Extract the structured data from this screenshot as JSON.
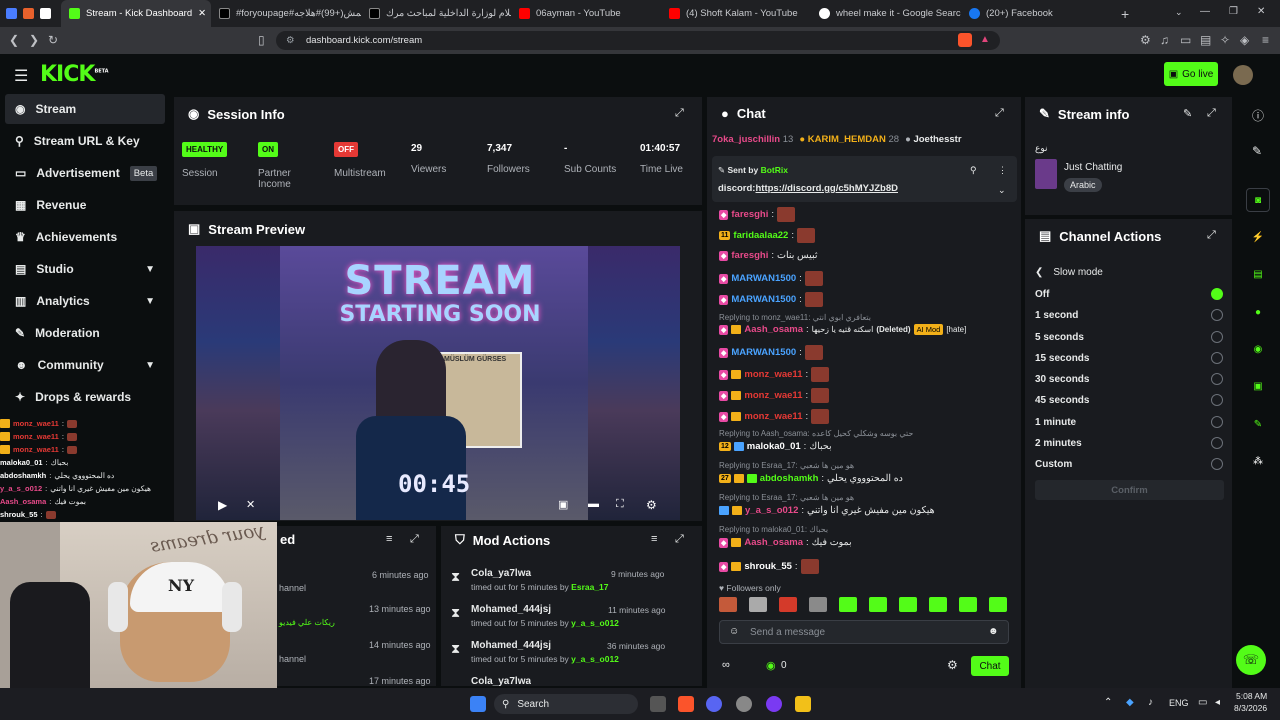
{
  "browser": {
    "tabs": [
      {
        "label": "Stream - Kick Dashboard",
        "active": true
      },
      {
        "label": "#foryoupage#عمش(+99)#هلاجه"
      },
      {
        "label": "استعلام لوزارة الداخلية لمباحث مرك"
      },
      {
        "label": "06ayman - YouTube"
      },
      {
        "label": "(4) Shoft Kalam - YouTube"
      },
      {
        "label": "wheel make it - Google Search"
      },
      {
        "label": "(20+) Facebook"
      }
    ],
    "url": "dashboard.kick.com/stream"
  },
  "header": {
    "logo": "KICK",
    "logo_sup": "BETA",
    "go_live": "Go live"
  },
  "sidebar": {
    "items": [
      {
        "label": "Stream",
        "icon": "broadcast-icon"
      },
      {
        "label": "Stream URL & Key",
        "icon": "link-icon"
      },
      {
        "label": "Advertisement",
        "icon": "monitor-icon",
        "badge": "Beta"
      },
      {
        "label": "Revenue",
        "icon": "revenue-icon"
      },
      {
        "label": "Achievements",
        "icon": "trophy-icon"
      },
      {
        "label": "Studio",
        "icon": "studio-icon"
      },
      {
        "label": "Analytics",
        "icon": "analytics-icon"
      },
      {
        "label": "Moderation",
        "icon": "wrench-icon"
      },
      {
        "label": "Community",
        "icon": "people-icon"
      },
      {
        "label": "Drops & rewards",
        "icon": "gift-icon"
      }
    ]
  },
  "session": {
    "title": "Session Info",
    "stats": [
      {
        "value": "HEALTHY",
        "label": "Session",
        "badge": true,
        "color": "#53fc18"
      },
      {
        "value": "ON",
        "label": "Partner Income",
        "badge": true,
        "color": "#53fc18"
      },
      {
        "value": "OFF",
        "label": "Multistream",
        "badge": true,
        "color": "#e53935"
      },
      {
        "value": "29",
        "label": "Viewers"
      },
      {
        "value": "7,347",
        "label": "Followers"
      },
      {
        "value": "-",
        "label": "Sub Counts"
      },
      {
        "value": "01:40:57",
        "label": "Time Live"
      }
    ]
  },
  "preview": {
    "title": "Stream Preview",
    "overlay_line1": "STREAM",
    "overlay_line2": "STARTING SOON",
    "poster": "MÜSLÜM GÜRSES",
    "countdown": "00:45"
  },
  "recent": {
    "title": "ed",
    "items": [
      {
        "time": "6 minutes ago",
        "sub": "hannel"
      },
      {
        "time": "13 minutes ago",
        "sub": "ريكات علي فيديو"
      },
      {
        "time": "14 minutes ago",
        "sub": "hannel"
      },
      {
        "time": "17 minutes ago",
        "sub": ""
      }
    ]
  },
  "mod_actions": {
    "title": "Mod Actions",
    "items": [
      {
        "user": "Cola_ya7lwa",
        "time": "9 minutes ago",
        "action": "timed out for 5 minutes by",
        "by": "Esraa_17"
      },
      {
        "user": "Mohamed_444jsj",
        "time": "11 minutes ago",
        "action": "timed out for 5 minutes by",
        "by": "y_a_s_o012"
      },
      {
        "user": "Mohamed_444jsj",
        "time": "36 minutes ago",
        "action": "timed out for 5 minutes by",
        "by": "y_a_s_o012"
      },
      {
        "user": "Cola_ya7lwa",
        "time": "",
        "action": "",
        "by": ""
      }
    ]
  },
  "chat": {
    "title": "Chat",
    "top_gifters": [
      {
        "name": "7oka_juschillin",
        "count": "13"
      },
      {
        "name": "KARIM_HEMDAN",
        "count": "28"
      },
      {
        "name": "Joethesstr",
        "count": ""
      }
    ],
    "pinned": {
      "sent_by": "Sent by",
      "bot": "BotRix",
      "text": "discord:",
      "link": "https://discord.gg/c5hMYJZb8D"
    },
    "messages": [
      {
        "name": "faresghi",
        "color": "#e84a8a",
        "text": ""
      },
      {
        "name": "faridaalaa22",
        "color": "#53fc18",
        "text": "",
        "level": "11"
      },
      {
        "name": "faresghi",
        "color": "#e84a8a",
        "text": "ثبيس بنات"
      },
      {
        "name": "MARWAN1500",
        "color": "#4aa3ff",
        "text": ""
      },
      {
        "name": "MARWAN1500",
        "color": "#4aa3ff",
        "text": ""
      },
      {
        "reply": "Replying to monz_wae11: بتعافري ابوي انتي",
        "name": "Aash_osama",
        "color": "#e84a8a",
        "text": "اسكته قتيه يا زحيها",
        "deleted": "(Deleted)",
        "ai": "AI Mod",
        "tag": "[hate]"
      },
      {
        "name": "MARWAN1500",
        "color": "#4aa3ff",
        "text": ""
      },
      {
        "name": "monz_wae11",
        "color": "#e53935",
        "text": ""
      },
      {
        "name": "monz_wae11",
        "color": "#e53935",
        "text": ""
      },
      {
        "name": "monz_wae11",
        "color": "#e53935",
        "text": ""
      },
      {
        "reply": "Replying to Aash_osama: حتي بوسه وشكلي كحيل كاعده",
        "name": "maloka0_01",
        "color": "#ffffff",
        "text": "بحباك",
        "level": "12"
      },
      {
        "reply": "Replying to Esraa_17: هو مين ها شعبي",
        "name": "abdoshamkh",
        "color": "#53fc18",
        "text": "ده المحتوووي يحلي",
        "level": "27"
      },
      {
        "reply": "Replying to Esraa_17: هو مين ها شعبي",
        "name": "y_a_s_o012",
        "color": "#e84a8a",
        "text": "هيكون مين مفيش غيري انا واتني"
      },
      {
        "reply": "Replying to maloka0_01: بحباك",
        "name": "Aash_osama",
        "color": "#e84a8a",
        "text": "بموت فيك"
      },
      {
        "name": "shrouk_55",
        "color": "#ffffff",
        "text": ""
      }
    ],
    "followers_only": "Followers only",
    "placeholder": "Send a message",
    "count": "0",
    "send": "Chat"
  },
  "stream_info": {
    "title": "Stream info",
    "category_label": "نوع",
    "category": "Just Chatting",
    "tag": "Arabic"
  },
  "channel_actions": {
    "title": "Channel Actions",
    "slow_mode": "Slow mode",
    "options": [
      "Off",
      "1 second",
      "5 seconds",
      "15 seconds",
      "30 seconds",
      "45 seconds",
      "1 minute",
      "2 minutes",
      "Custom"
    ],
    "selected": "Off",
    "confirm": "Confirm"
  },
  "overlay_chat": [
    {
      "name": "monz_wae11",
      "color": "#e53935",
      "text": ""
    },
    {
      "name": "monz_wae11",
      "color": "#e53935",
      "text": ""
    },
    {
      "name": "monz_wae11",
      "color": "#e53935",
      "text": ""
    },
    {
      "name": "maloka0_01",
      "color": "#ffffff",
      "text": "بحباك"
    },
    {
      "name": "abdoshamkh",
      "color": "#ffffff",
      "text": "ده المحتوووي يحلي"
    },
    {
      "name": "y_a_s_o012",
      "color": "#e84a8a",
      "text": "هيكون مين مفيش غيري انا واتني"
    },
    {
      "name": "Aash_osama",
      "color": "#e84a8a",
      "text": "بموت فيك"
    },
    {
      "name": "shrouk_55",
      "color": "#ffffff",
      "text": ""
    }
  ],
  "webcam": {
    "text": "your dreams",
    "cap": "NY"
  },
  "taskbar": {
    "search": "Search",
    "lang": "ENG",
    "time": "5:08 AM",
    "date": "8/3/2026"
  },
  "colors": {
    "accent": "#53fc18",
    "panel": "#191b1f",
    "bg": "#0b0e0f",
    "danger": "#e53935"
  }
}
